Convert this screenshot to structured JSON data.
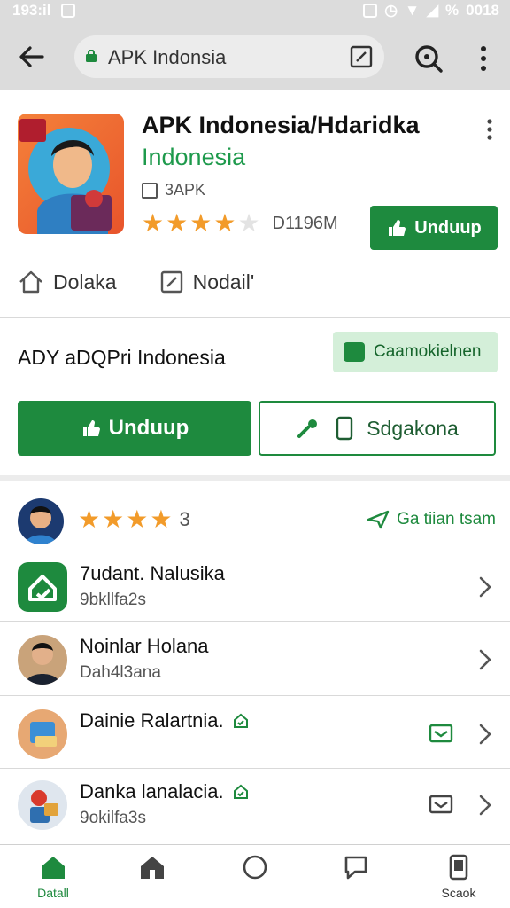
{
  "statusbar": {
    "time_left": "193:il",
    "time_right": "0018",
    "battery": "%"
  },
  "toolbar": {
    "url": "APK Indonsia"
  },
  "app": {
    "title": "APK Indonesia/Hdaridka",
    "developer": "Indonesia",
    "tag": "3APK",
    "rating_count": "D1196M",
    "install_label": "Unduup"
  },
  "links": {
    "first": "Dolaka",
    "second": "Nodail'"
  },
  "section": {
    "title": "ADY aDQPri Indonesia",
    "chip_label": "Caamokielnen",
    "install_label": "Unduup",
    "secondary_label": "Sdgakona"
  },
  "review": {
    "count": "3",
    "link_label": "Ga tiian tsam"
  },
  "list": [
    {
      "title": "7udant. Nalusika",
      "subtitle": "9bkllfa2s"
    },
    {
      "title": "Noinlar Holana",
      "subtitle": "Dah4l3ana"
    },
    {
      "title": "Dainie Ralartnia.",
      "subtitle": ""
    },
    {
      "title": "Danka lanalacia.",
      "subtitle": "9okilfa3s"
    }
  ],
  "nav": [
    {
      "label": "Datall",
      "icon": "home-filled-icon"
    },
    {
      "label": "",
      "icon": "store-icon"
    },
    {
      "label": "",
      "icon": "circle-icon"
    },
    {
      "label": "",
      "icon": "chat-icon"
    },
    {
      "label": "Scaok",
      "icon": "phone-icon"
    }
  ],
  "colors": {
    "accent": "#1e8a3e",
    "star": "#f29b2a",
    "dev": "#1e9a4c"
  }
}
